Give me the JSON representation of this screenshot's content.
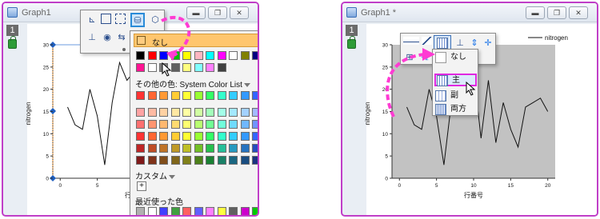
{
  "window1": {
    "title": "Graph1",
    "layer": "1",
    "y_label": "nitrogen",
    "x_label": "行番号",
    "x_ticks": [
      "0",
      "5",
      "10",
      "15",
      "20"
    ],
    "y_ticks": [
      "0",
      "5",
      "10",
      "15",
      "20",
      "25",
      "30"
    ],
    "palette": {
      "none_label": "なし",
      "more_colors_label": "その他の色: System Color List",
      "custom_label": "カスタム",
      "add_label": "+",
      "recent_label": "最近使った色",
      "basic_colors": [
        "#000000",
        "#ff0000",
        "#0000ff",
        "#00c000",
        "#ffff00",
        "#ffb6c1",
        "#00ffff",
        "#ff00ff",
        "#ffffff",
        "#808000",
        "#000080",
        "#800080",
        "#008080",
        "#008000",
        "#00008b",
        "#a020f0",
        "#ff1493",
        "#ffffff",
        "#808080",
        "#606060",
        "#ffff80",
        "#80ffff",
        "#ff80ff",
        "#404040"
      ],
      "system_colors": [
        "#ff3333",
        "#ff6633",
        "#ff9933",
        "#ffcc33",
        "#ffff33",
        "#99ff33",
        "#33ff66",
        "#33ffcc",
        "#33ccff",
        "#3399ff",
        "#3366ff",
        "#6633ff",
        "#cc33ff",
        "#ff33cc"
      ],
      "recent_colors": [
        "#b0b0b0",
        "#ffffff",
        "#4040ff",
        "#40a040",
        "#ff6060",
        "#6060ff",
        "#ff80ff",
        "#ffff40",
        "#606060",
        "#cc00cc",
        "#00cc00",
        "#ff4080",
        "#ffa060",
        "#ffc0c0"
      ]
    }
  },
  "window2": {
    "title": "Graph1 *",
    "layer": "1",
    "y_label": "nitrogen",
    "x_label": "行番号",
    "legend_label": "nitrogen",
    "x_ticks": [
      "0",
      "5",
      "10",
      "15",
      "20"
    ],
    "y_ticks": [
      "0",
      "5",
      "10",
      "15",
      "20",
      "25",
      "30"
    ],
    "grid_menu": {
      "items": [
        "なし",
        "主",
        "副",
        "両方"
      ]
    }
  },
  "chart_data": {
    "type": "line",
    "xlabel": "行番号",
    "ylabel": "nitrogen",
    "xlim": [
      -1,
      21
    ],
    "ylim": [
      0,
      30
    ],
    "series": [
      {
        "name": "nitrogen",
        "x": [
          1,
          2,
          3,
          4,
          5,
          6,
          7,
          8,
          9,
          10,
          11,
          12,
          13,
          14,
          15,
          16,
          17,
          18,
          19,
          20
        ],
        "values": [
          16,
          12,
          11,
          20,
          14,
          3,
          17,
          26,
          22,
          24,
          9,
          22,
          8,
          17,
          11,
          7,
          16,
          17,
          18,
          15
        ]
      }
    ]
  }
}
